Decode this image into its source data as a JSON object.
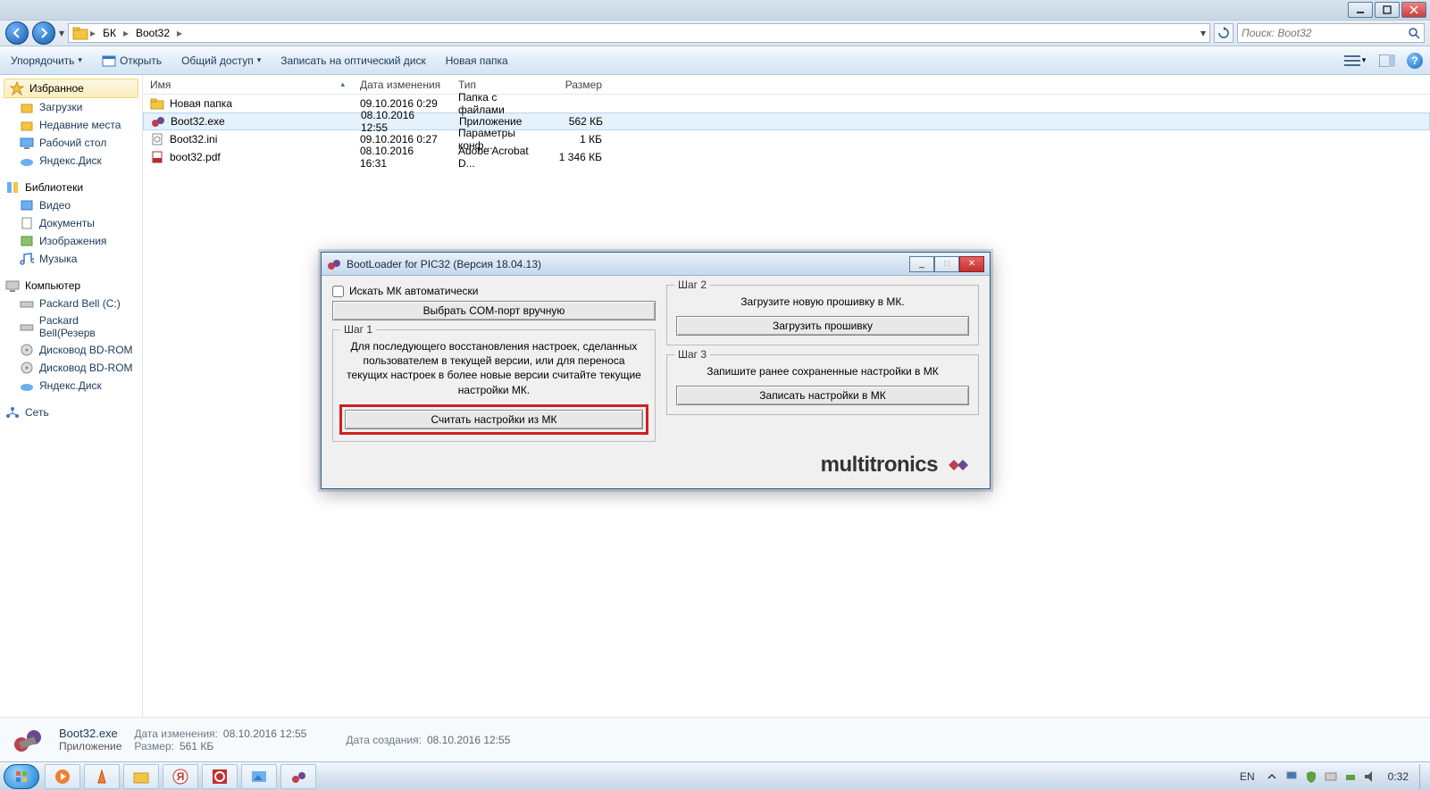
{
  "titlebar": {},
  "nav": {
    "breadcrumb": [
      "БК",
      "Boot32"
    ],
    "search_placeholder": "Поиск: Boot32"
  },
  "toolbar": {
    "organize": "Упорядочить",
    "open": "Открыть",
    "share": "Общий доступ",
    "burn": "Записать на оптический диск",
    "newfolder": "Новая папка"
  },
  "sidebar": {
    "favorites_title": "Избранное",
    "favorites": [
      "Загрузки",
      "Недавние места",
      "Рабочий стол",
      "Яндекс.Диск"
    ],
    "libraries_title": "Библиотеки",
    "libraries": [
      "Видео",
      "Документы",
      "Изображения",
      "Музыка"
    ],
    "computer_title": "Компьютер",
    "computer": [
      "Packard Bell (C:)",
      "Packard Bell(Резерв",
      "Дисковод BD-ROM",
      "Дисковод BD-ROM",
      "Яндекс.Диск"
    ],
    "network": "Сеть"
  },
  "columns": {
    "name": "Имя",
    "date": "Дата изменения",
    "type": "Тип",
    "size": "Размер"
  },
  "files": [
    {
      "name": "Новая папка",
      "date": "09.10.2016 0:29",
      "type": "Папка с файлами",
      "size": "",
      "icon": "folder"
    },
    {
      "name": "Boot32.exe",
      "date": "08.10.2016 12:55",
      "type": "Приложение",
      "size": "562 КБ",
      "icon": "app",
      "selected": true
    },
    {
      "name": "Boot32.ini",
      "date": "09.10.2016 0:27",
      "type": "Параметры конф...",
      "size": "1 КБ",
      "icon": "ini"
    },
    {
      "name": "boot32.pdf",
      "date": "08.10.2016 16:31",
      "type": "Adobe Acrobat D...",
      "size": "1 346 КБ",
      "icon": "pdf"
    }
  ],
  "details": {
    "name": "Boot32.exe",
    "type": "Приложение",
    "date_mod_lbl": "Дата изменения:",
    "date_mod": "08.10.2016 12:55",
    "size_lbl": "Размер:",
    "size": "561 КБ",
    "date_create_lbl": "Дата создания:",
    "date_create": "08.10.2016 12:55"
  },
  "dialog": {
    "title": "BootLoader for PIC32   (Версия 18.04.13)",
    "auto_search": "Искать МК автоматически",
    "select_com": "Выбрать COM-порт вручную",
    "step1": "Шаг 1",
    "step1_text": "Для последующего восстановления настроек, сделанных пользователем в текущей версии, или для переноса текущих настроек в более новые версии считайте текущие настройки МК.",
    "read_settings": "Считать настройки из МК",
    "step2": "Шаг 2",
    "step2_text": "Загрузите новую прошивку в МК.",
    "load_fw": "Загрузить прошивку",
    "step3": "Шаг 3",
    "step3_text": "Запишите ранее сохраненные настройки в МК",
    "write_settings": "Записать настройки в МК",
    "logo": "multitronics"
  },
  "taskbar": {
    "lang": "EN",
    "time": "0:32"
  }
}
